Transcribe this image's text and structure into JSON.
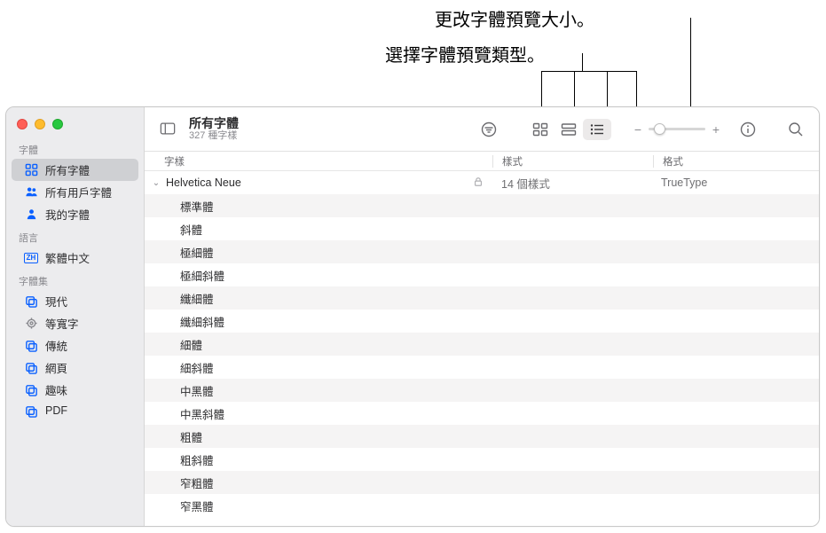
{
  "callouts": {
    "size": "更改字體預覽大小。",
    "type": "選擇字體預覽類型。"
  },
  "sidebar": {
    "sections": {
      "fonts": {
        "label": "字體",
        "items": [
          "所有字體",
          "所有用戶字體",
          "我的字體"
        ]
      },
      "language": {
        "label": "語言",
        "items": [
          "繁體中文"
        ]
      },
      "collections": {
        "label": "字體集",
        "items": [
          "現代",
          "等寬字",
          "傳統",
          "網頁",
          "趣味",
          "PDF"
        ]
      }
    }
  },
  "toolbar": {
    "title": "所有字體",
    "subtitle": "327 種字樣"
  },
  "columns": {
    "c1": "字樣",
    "c2": "樣式",
    "c3": "格式"
  },
  "family": {
    "name": "Helvetica Neue",
    "styles_count": "14 個樣式",
    "format": "TrueType"
  },
  "styles": [
    "標準體",
    "斜體",
    "極細體",
    "極細斜體",
    "纖細體",
    "纖細斜體",
    "細體",
    "細斜體",
    "中黑體",
    "中黑斜體",
    "粗體",
    "粗斜體",
    "窄粗體",
    "窄黑體"
  ]
}
